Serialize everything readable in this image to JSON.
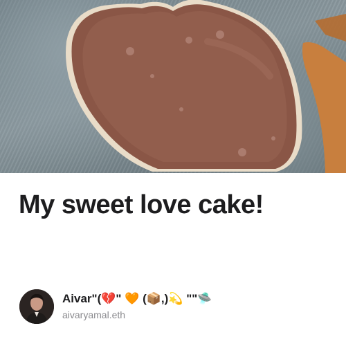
{
  "post": {
    "title": "My sweet love cake!",
    "cover_image": "heart-shaped-chocolate-cake-on-granite-board"
  },
  "author": {
    "name": "Aivar\"(💔\" 🧡    (📦,)💫   \"\"🛸",
    "handle": "aivaryamal.eth",
    "avatar": "profile-photo"
  }
}
